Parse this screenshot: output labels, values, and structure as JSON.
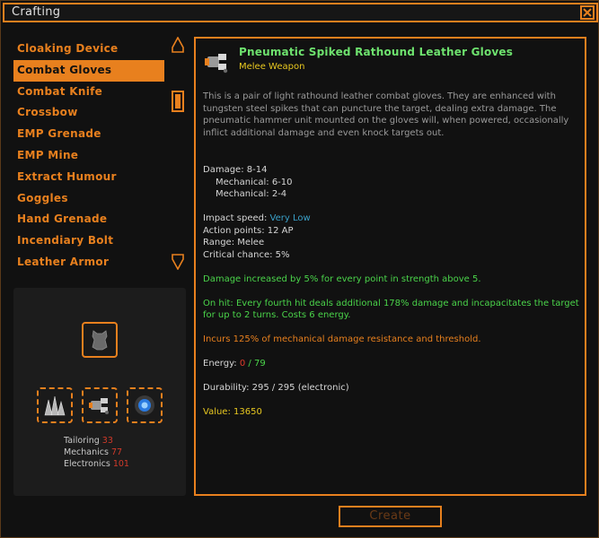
{
  "window": {
    "title": "Crafting"
  },
  "recipes": [
    "Cloaking Device",
    "Combat Gloves",
    "Combat Knife",
    "Crossbow",
    "EMP Grenade",
    "EMP Mine",
    "Extract Humour",
    "Goggles",
    "Hand Grenade",
    "Incendiary Bolt",
    "Leather Armor"
  ],
  "selected_index": 1,
  "ingredients": {
    "result_icon": "leather-hide-icon",
    "slots": [
      "spikes-icon",
      "pneumatic-gloves-icon",
      "power-cell-icon"
    ],
    "skills": [
      {
        "name": "Tailoring",
        "value": "33"
      },
      {
        "name": "Mechanics",
        "value": "77"
      },
      {
        "name": "Electronics",
        "value": "101"
      }
    ]
  },
  "item": {
    "name": "Pneumatic Spiked Rathound Leather Gloves",
    "type": "Melee Weapon",
    "description": "This is a pair of light rathound leather combat gloves. They are enhanced with tungsten steel spikes that can puncture the target, dealing extra damage. The pneumatic hammer unit mounted on the gloves will, when powered, occasionally inflict additional damage and even knock targets out.",
    "damage": "Damage: 8-14",
    "damage_mech1": "Mechanical: 6-10",
    "damage_mech2": "Mechanical: 2-4",
    "impact_label": "Impact speed:",
    "impact_value": "Very Low",
    "action_points": "Action points: 12 AP",
    "range": "Range: Melee",
    "crit": "Critical chance: 5%",
    "strength_bonus": "Damage increased by 5% for every point in strength above 5.",
    "on_hit": "On hit: Every fourth hit deals additional 178% damage and incapacitates the target for up to 2 turns. Costs 6 energy.",
    "incurs": "Incurs 125% of mechanical damage resistance and threshold.",
    "energy_label": "Energy:",
    "energy_current": "0",
    "energy_sep": "/",
    "energy_max": "79",
    "durability": "Durability: 295 / 295 (electronic)",
    "value": "Value: 13650"
  },
  "buttons": {
    "create": "Create"
  },
  "colors": {
    "accent": "#e8801e",
    "green": "#4ad44a",
    "gold": "#e8c820",
    "red": "#e23a2a",
    "blue": "#3aa0c8"
  }
}
